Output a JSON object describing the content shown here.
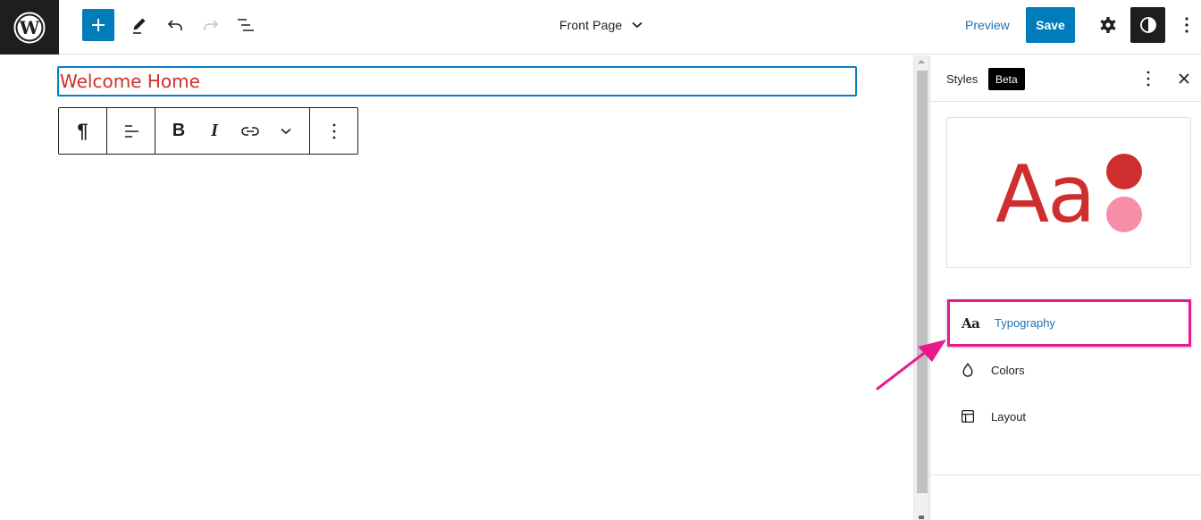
{
  "topbar": {
    "logo": "wordpress-logo",
    "add_block_label": "+",
    "tools": [
      "edit-tool",
      "undo",
      "redo",
      "list-view"
    ],
    "document_title": "Front Page",
    "preview_label": "Preview",
    "save_label": "Save",
    "accent_color": "#007cba"
  },
  "canvas": {
    "heading_text": "Welcome Home",
    "heading_color": "#cf2e2e",
    "block_toolbar": {
      "paragraph_symbol": "¶",
      "bold_label": "B",
      "italic_label": "I"
    }
  },
  "sidebar": {
    "title": "Styles",
    "badge": "Beta",
    "preview": {
      "sample_text": "Aa",
      "colors": [
        "#cf2e2e",
        "#f78da7"
      ]
    },
    "nav": [
      {
        "label": "Typography",
        "icon": "typography-icon",
        "highlighted": true
      },
      {
        "label": "Colors",
        "icon": "droplet-icon",
        "highlighted": false
      },
      {
        "label": "Layout",
        "icon": "layout-icon",
        "highlighted": false
      }
    ],
    "highlight_color": "#e8198b"
  }
}
